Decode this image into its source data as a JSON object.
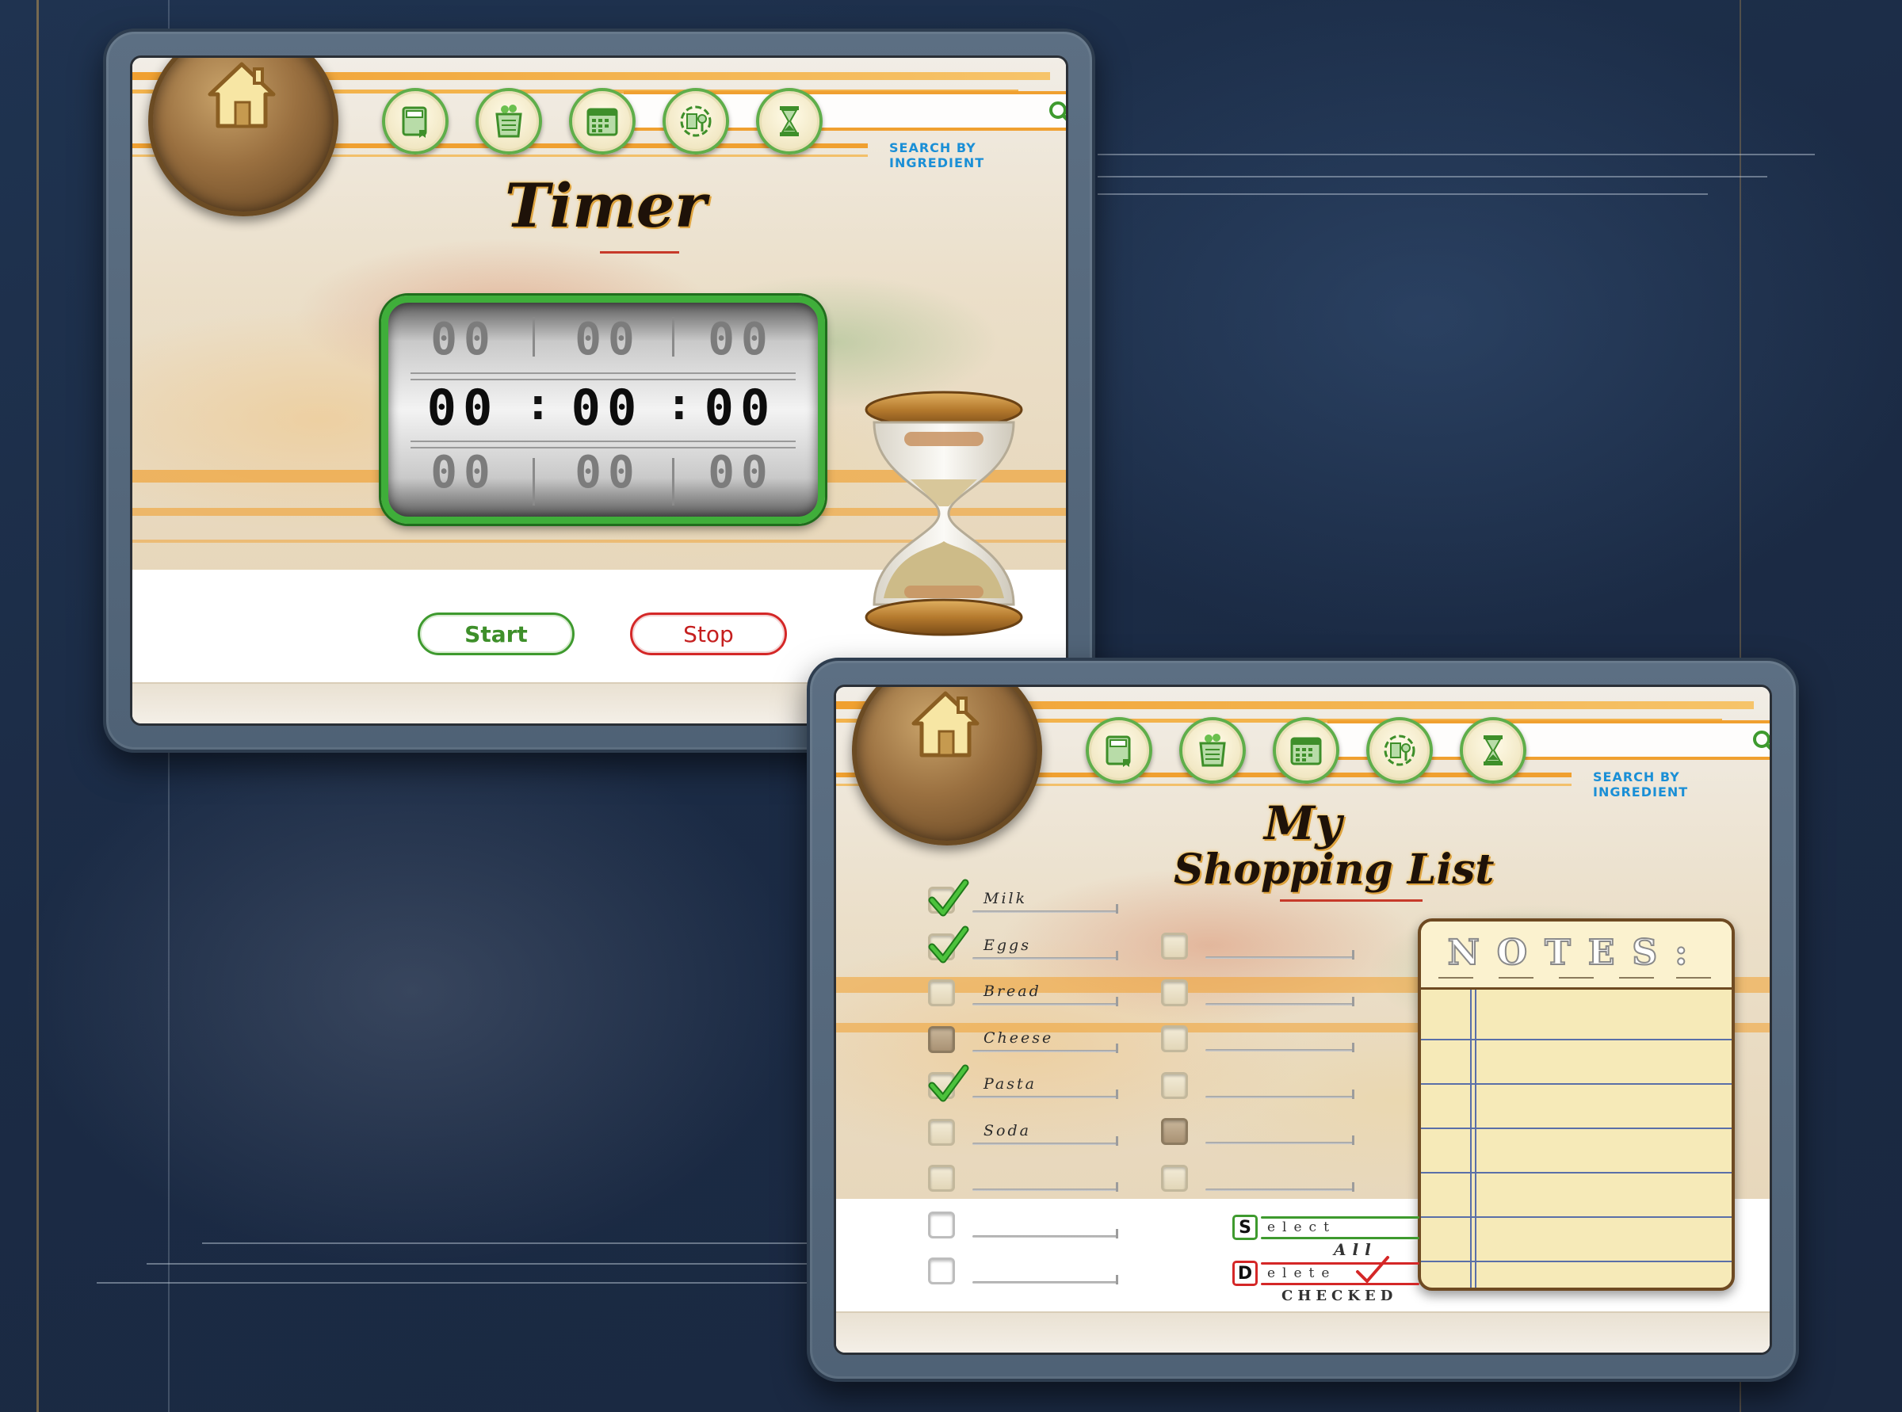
{
  "colors": {
    "accent_orange": "#f0a030",
    "accent_green": "#3fae3a",
    "stop_red": "#d42727",
    "search_blue": "#1a8fd6"
  },
  "icons": {
    "home": "home-icon",
    "nav": [
      "recipe-book-icon",
      "grocery-bag-icon",
      "calendar-icon",
      "measuring-tools-icon",
      "hourglass-icon"
    ],
    "search": "search-icon"
  },
  "timer_screen": {
    "search_label": "SEARCH BY INGREDIENT",
    "title": "Timer",
    "display": {
      "top": [
        "00",
        "00",
        "00"
      ],
      "main": [
        "00",
        "00",
        "00"
      ],
      "bottom": [
        "00",
        "00",
        "00"
      ],
      "separator": ":"
    },
    "start_label": "Start",
    "stop_label": "Stop"
  },
  "shopping_screen": {
    "search_label": "SEARCH BY INGREDIENT",
    "title_line1": "My",
    "title_line2": "Shopping List",
    "items_left": [
      {
        "label": "Milk",
        "checked": true
      },
      {
        "label": "Eggs",
        "checked": true
      },
      {
        "label": "Bread",
        "checked": false
      },
      {
        "label": "Cheese",
        "checked": false
      },
      {
        "label": "Pasta",
        "checked": true
      },
      {
        "label": "Soda",
        "checked": false
      },
      {
        "label": "",
        "checked": false
      },
      {
        "label": "",
        "checked": false
      },
      {
        "label": "",
        "checked": false
      }
    ],
    "items_right_count": 6,
    "notes_title": "NOTES:",
    "select_all": {
      "key": "S",
      "line1": "elect",
      "line2": "All"
    },
    "delete_checked": {
      "key": "D",
      "line1": "elete",
      "line2": "CHECKED"
    }
  }
}
